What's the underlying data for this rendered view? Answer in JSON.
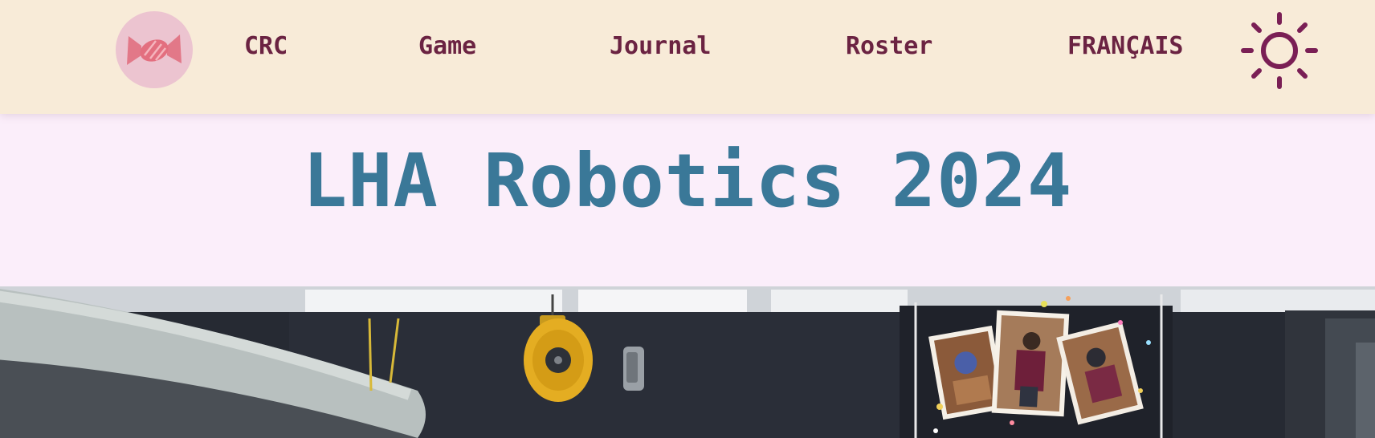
{
  "nav": {
    "logo_icon": "candy-icon",
    "links": [
      {
        "label": "CRC"
      },
      {
        "label": "Game"
      },
      {
        "label": "Journal"
      },
      {
        "label": "Roster"
      },
      {
        "label": "FRANÇAIS"
      }
    ],
    "theme_icon": "sun-icon"
  },
  "hero": {
    "title": "LHA Robotics 2024"
  },
  "photo": {
    "subject": "robotics-workshop-photo"
  },
  "colors": {
    "nav_bg": "#f8ebd8",
    "nav_text": "#6b2342",
    "page_bg": "#fbeefa",
    "title": "#3a7898",
    "sun": "#7a1f55"
  }
}
